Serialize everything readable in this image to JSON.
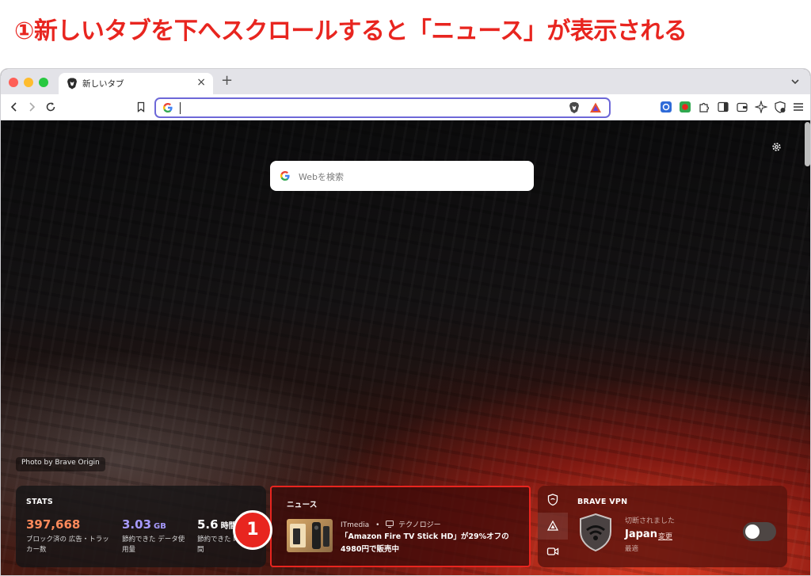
{
  "instruction_heading": "①新しいタブを下へスクロールすると「ニュース」が表示される",
  "tab": {
    "title": "新しいタブ",
    "close": "×",
    "new_tab": "+"
  },
  "address_bar": {
    "value": "",
    "placeholder": ""
  },
  "ntp": {
    "search_placeholder": "Webを検索",
    "photo_credit": "Photo by Brave Origin"
  },
  "stats": {
    "title": "STATS",
    "items": [
      {
        "value": "397,668",
        "unit": "",
        "desc": "ブロック済の 広告・トラッカー数",
        "color": "#ff8a5b"
      },
      {
        "value": "3.03",
        "unit": "GB",
        "desc": "節約できた データ使用量",
        "color": "#a79bff"
      },
      {
        "value": "5.6",
        "unit": "時間",
        "desc": "節約できた 時間",
        "color": "#ffffff"
      }
    ]
  },
  "step_badge": "1",
  "news": {
    "title": "ニュース",
    "source": "ITmedia",
    "separator": "•",
    "category": "テクノロジー",
    "headline": "「Amazon Fire TV Stick HD」が29%オフの4980円で販売中"
  },
  "vpn": {
    "title": "BRAVE VPN",
    "status": "切断されました",
    "region": "Japan",
    "change": "変更",
    "optimal": "最適",
    "connected": false
  },
  "colors": {
    "accent": "#e8251f",
    "url_focus": "#6d68d8"
  }
}
